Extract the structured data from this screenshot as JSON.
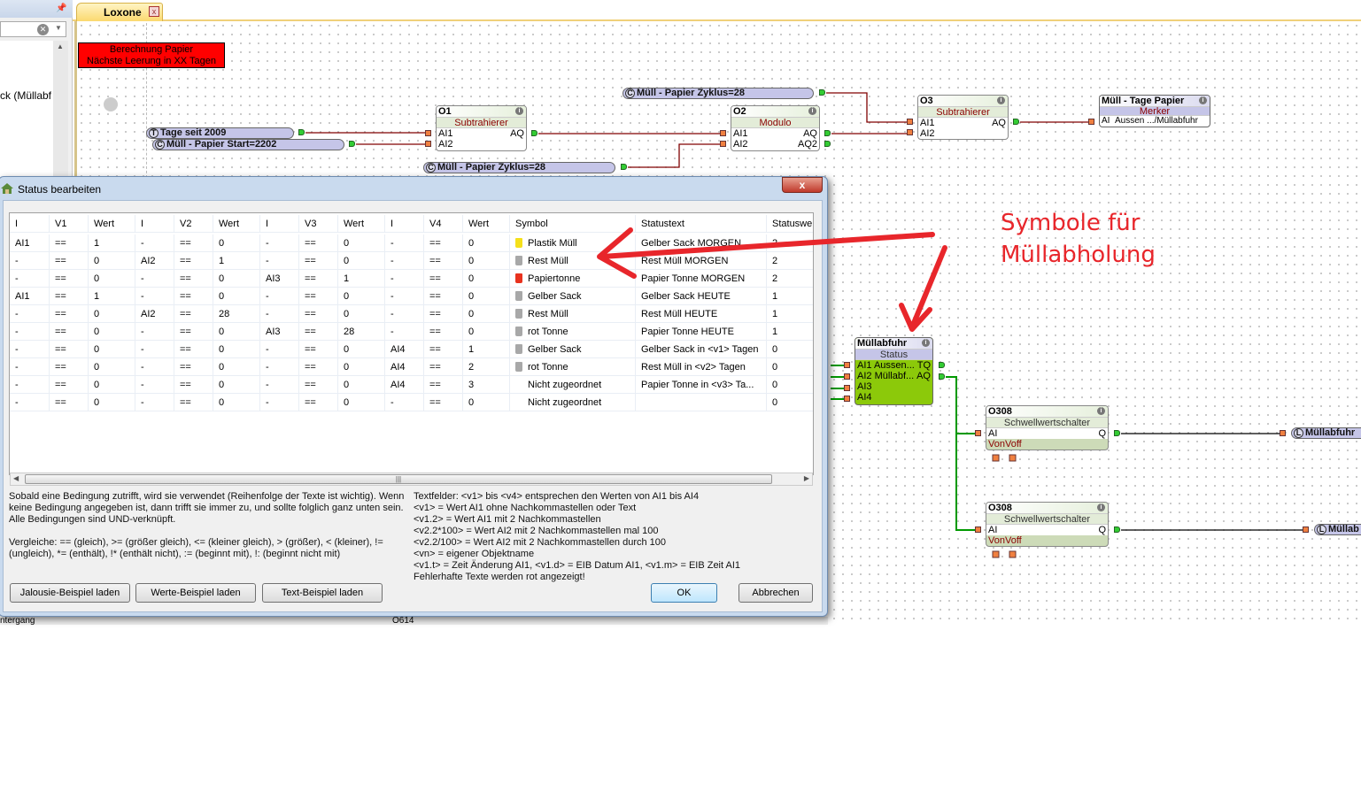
{
  "left_panel": {
    "search_value": "",
    "tree_item": "ck (Müllabf"
  },
  "tab": {
    "label": "Loxone"
  },
  "canvas": {
    "note": {
      "line1": "Berechnung Papier",
      "line2": "Nächste Leerung in XX Tagen"
    },
    "constants": {
      "tage": {
        "type": "T",
        "label": "Tage seit 2009"
      },
      "start": {
        "type": "C",
        "label": "Müll - Papier Start=2202"
      },
      "zyklus_lower": {
        "type": "C",
        "label": "Müll - Papier Zyklus=28"
      },
      "zyklus_upper": {
        "type": "C",
        "label": "Müll - Papier Zyklus=28"
      }
    },
    "o1": {
      "id": "O1",
      "type": "Subtrahierer",
      "in1": "AI1",
      "in2": "AI2",
      "out1": "AQ"
    },
    "o2": {
      "id": "O2",
      "type": "Modulo",
      "in1": "AI1",
      "in2": "AI2",
      "out1": "AQ",
      "out2": "AQ2"
    },
    "o3": {
      "id": "O3",
      "type": "Subtrahierer",
      "in1": "AI1",
      "in2": "AI2",
      "out1": "AQ"
    },
    "merker": {
      "id": "Müll - Tage Papier",
      "type": "Merker",
      "in1": "AI",
      "value": "Aussen .../Müllabfuhr"
    },
    "status": {
      "id": "Müllabfuhr",
      "type": "Status",
      "in1": "AI1 Aussen...",
      "in2": "AI2 Müllabf...",
      "in3": "AI3",
      "in4": "AI4",
      "out1": "TQ",
      "out2": "AQ"
    },
    "sw1": {
      "id": "O308",
      "type": "Schwellwertschalter",
      "in1": "AI",
      "out1": "Q",
      "param": "VonVoff"
    },
    "sw2": {
      "id": "O308",
      "type": "Schwellwertschalter",
      "in1": "AI",
      "out1": "Q",
      "param": "VonVoff"
    },
    "out1": {
      "type": "L",
      "label": "Müllabfuhr"
    },
    "out2": {
      "type": "L",
      "label": "Müllab"
    },
    "annotation": {
      "line1": "Symbole für",
      "line2": "Müllabholung"
    }
  },
  "dialog": {
    "title": "Status bearbeiten",
    "close": "x",
    "columns": [
      "I",
      "V1",
      "Wert",
      "I",
      "V2",
      "Wert",
      "I",
      "V3",
      "Wert",
      "I",
      "V4",
      "Wert",
      "Symbol",
      "Statustext",
      "Statuswe"
    ],
    "rows": [
      {
        "c": [
          "AI1",
          "==",
          "1",
          "-",
          "==",
          "0",
          "-",
          "==",
          "0",
          "-",
          "==",
          "0"
        ],
        "symbol": "Plastik Müll",
        "icon": "yellow",
        "text": "Gelber Sack MORGEN",
        "value": "2"
      },
      {
        "c": [
          "-",
          "==",
          "0",
          "AI2",
          "==",
          "1",
          "-",
          "==",
          "0",
          "-",
          "==",
          "0"
        ],
        "symbol": "Rest Müll",
        "icon": "gray",
        "text": "Rest Müll MORGEN",
        "value": "2"
      },
      {
        "c": [
          "-",
          "==",
          "0",
          "-",
          "==",
          "0",
          "AI3",
          "==",
          "1",
          "-",
          "==",
          "0"
        ],
        "symbol": "Papiertonne",
        "icon": "red",
        "text": "Papier Tonne MORGEN",
        "value": "2"
      },
      {
        "c": [
          "AI1",
          "==",
          "1",
          "-",
          "==",
          "0",
          "-",
          "==",
          "0",
          "-",
          "==",
          "0"
        ],
        "symbol": "Gelber Sack",
        "icon": "gray",
        "text": "Gelber Sack HEUTE",
        "value": "1"
      },
      {
        "c": [
          "-",
          "==",
          "0",
          "AI2",
          "==",
          "28",
          "-",
          "==",
          "0",
          "-",
          "==",
          "0"
        ],
        "symbol": "Rest Müll",
        "icon": "gray",
        "text": "Rest Müll HEUTE",
        "value": "1"
      },
      {
        "c": [
          "-",
          "==",
          "0",
          "-",
          "==",
          "0",
          "AI3",
          "==",
          "28",
          "-",
          "==",
          "0"
        ],
        "symbol": "rot Tonne",
        "icon": "gray",
        "text": "Papier Tonne HEUTE",
        "value": "1"
      },
      {
        "c": [
          "-",
          "==",
          "0",
          "-",
          "==",
          "0",
          "-",
          "==",
          "0",
          "AI4",
          "==",
          "1"
        ],
        "symbol": "Gelber Sack",
        "icon": "gray",
        "text": "Gelber Sack in <v1> Tagen",
        "value": "0"
      },
      {
        "c": [
          "-",
          "==",
          "0",
          "-",
          "==",
          "0",
          "-",
          "==",
          "0",
          "AI4",
          "==",
          "2"
        ],
        "symbol": "rot Tonne",
        "icon": "gray",
        "text": "Rest Müll in <v2> Tagen",
        "value": "0"
      },
      {
        "c": [
          "-",
          "==",
          "0",
          "-",
          "==",
          "0",
          "-",
          "==",
          "0",
          "AI4",
          "==",
          "3"
        ],
        "symbol": "Nicht zugeordnet",
        "icon": "none",
        "text": "Papier Tonne in <v3> Ta...",
        "value": "0"
      },
      {
        "c": [
          "-",
          "==",
          "0",
          "-",
          "==",
          "0",
          "-",
          "==",
          "0",
          "-",
          "==",
          "0"
        ],
        "symbol": "Nicht zugeordnet",
        "icon": "none",
        "text": "",
        "value": "0"
      }
    ],
    "help_left": [
      "Sobald eine Bedingung zutrifft, wird sie verwendet (Reihenfolge der Texte ist wichtig). Wenn",
      "keine Bedingung angegeben ist, dann trifft sie immer zu, und sollte folglich ganz unten sein.",
      "Alle Bedingungen sind UND-verknüpft.",
      "",
      "Vergleiche: == (gleich), >= (größer gleich), <= (kleiner gleich), > (größer), < (kleiner), !=",
      "(ungleich), *= (enthält), !* (enthält nicht), := (beginnt mit), !: (beginnt nicht mit)"
    ],
    "help_right": [
      "Textfelder: <v1> bis <v4> entsprechen den Werten von AI1 bis AI4",
      "<v1> = Wert AI1 ohne Nachkommastellen oder Text",
      "<v1.2> = Wert AI1 mit 2 Nachkommastellen",
      "<v2.2*100> = Wert AI2 mit 2 Nachkommastellen mal 100",
      "<v2.2/100> = Wert AI2 mit 2 Nachkommastellen durch 100",
      "<vn> = eigener Objektname",
      "<v1.t> = Zeit Änderung AI1, <v1.d> = EIB Datum AI1, <v1.m> = EIB Zeit AI1",
      "Fehlerhafte Texte werden rot angezeigt!"
    ],
    "buttons": {
      "jalousie": "Jalousie-Beispiel laden",
      "werte": "Werte-Beispiel laden",
      "text": "Text-Beispiel laden",
      "ok": "OK",
      "cancel": "Abbrechen"
    }
  },
  "background_strip": {
    "left": "ntergang",
    "block": "O614"
  },
  "colors": {
    "wire": "#800000",
    "wire_active": "#009900",
    "annotation": "#e8262b",
    "status_block": "#8cc90a"
  }
}
